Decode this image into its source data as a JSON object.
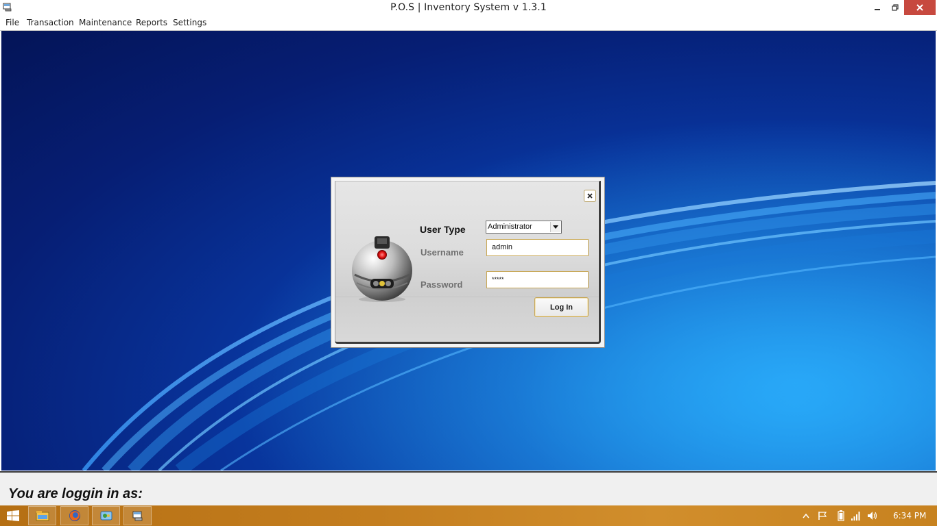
{
  "window": {
    "title": "P.O.S | Inventory System v 1.3.1",
    "controls": [
      "minimize-icon",
      "restore-icon",
      "close-icon"
    ]
  },
  "menu": {
    "items": [
      "File",
      "Transaction",
      "Maintenance",
      "Reports",
      "Settings"
    ]
  },
  "login_dialog": {
    "user_type_label": "User Type",
    "user_type_value": "Administrator",
    "username_label": "Username",
    "username_value": "admin",
    "password_label": "Password",
    "password_value": "*****",
    "login_button": "Log In",
    "close_icon": "close-icon",
    "logo_icon": "robot-sphere-icon"
  },
  "status": {
    "text": "You are loggin in as:"
  },
  "taskbar": {
    "apps": [
      "file-explorer-icon",
      "firefox-icon",
      "control-panel-icon",
      "pos-app-icon"
    ],
    "tray": [
      "show-hidden-icons-icon",
      "action-center-flag-icon",
      "battery-icon",
      "network-signal-icon",
      "volume-icon"
    ],
    "clock": "6:34 PM"
  },
  "colors": {
    "desktop_dark": "#041457",
    "desktop_light": "#1b8fe0",
    "taskbar": "#c47e1f",
    "close_button": "#c7493f",
    "field_border": "#c8a651"
  }
}
